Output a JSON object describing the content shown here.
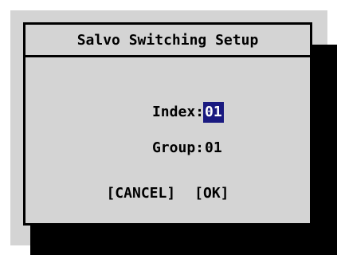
{
  "dialog": {
    "title": "Salvo Switching Setup",
    "fields": {
      "index": {
        "label": "Index:",
        "value": "01"
      },
      "group": {
        "label": "Group:",
        "value": "01"
      }
    },
    "buttons": {
      "cancel": "[CANCEL]",
      "ok": "[OK]"
    }
  },
  "colors": {
    "panel": "#d4d4d4",
    "border": "#000000",
    "selection": "#1a1a80",
    "selection_text": "#ffffff"
  }
}
